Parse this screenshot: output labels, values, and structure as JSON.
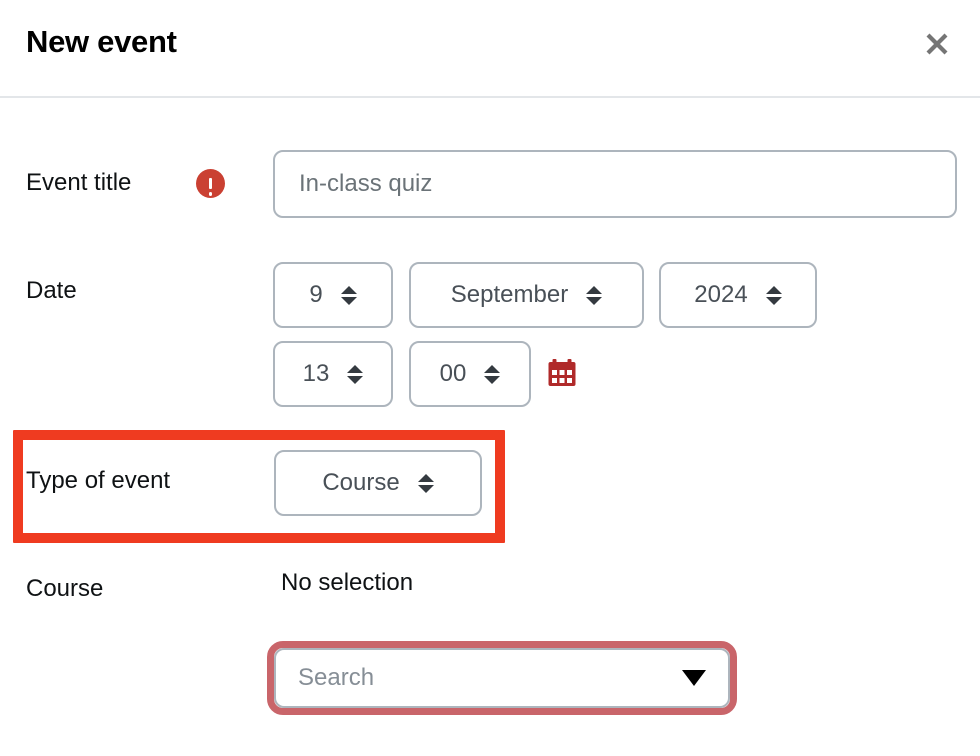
{
  "header": {
    "title": "New event",
    "close_icon": "close-icon"
  },
  "form": {
    "event_title": {
      "label": "Event title",
      "required_icon": "exclamation-circle-icon",
      "value": "In-class quiz",
      "placeholder": "Event title"
    },
    "date": {
      "label": "Date",
      "day": "9",
      "month": "September",
      "year": "2024",
      "hour": "13",
      "minute": "00",
      "calendar_icon": "calendar-icon"
    },
    "type_of_event": {
      "label": "Type of event",
      "value": "Course"
    },
    "course": {
      "label": "Course",
      "selection": "No selection",
      "search_placeholder": "Search",
      "caret_icon": "caret-down-icon"
    }
  },
  "annotations": {
    "type_of_event_highlight_color": "#ef3b20",
    "search_highlight_color": "#c9656a"
  }
}
